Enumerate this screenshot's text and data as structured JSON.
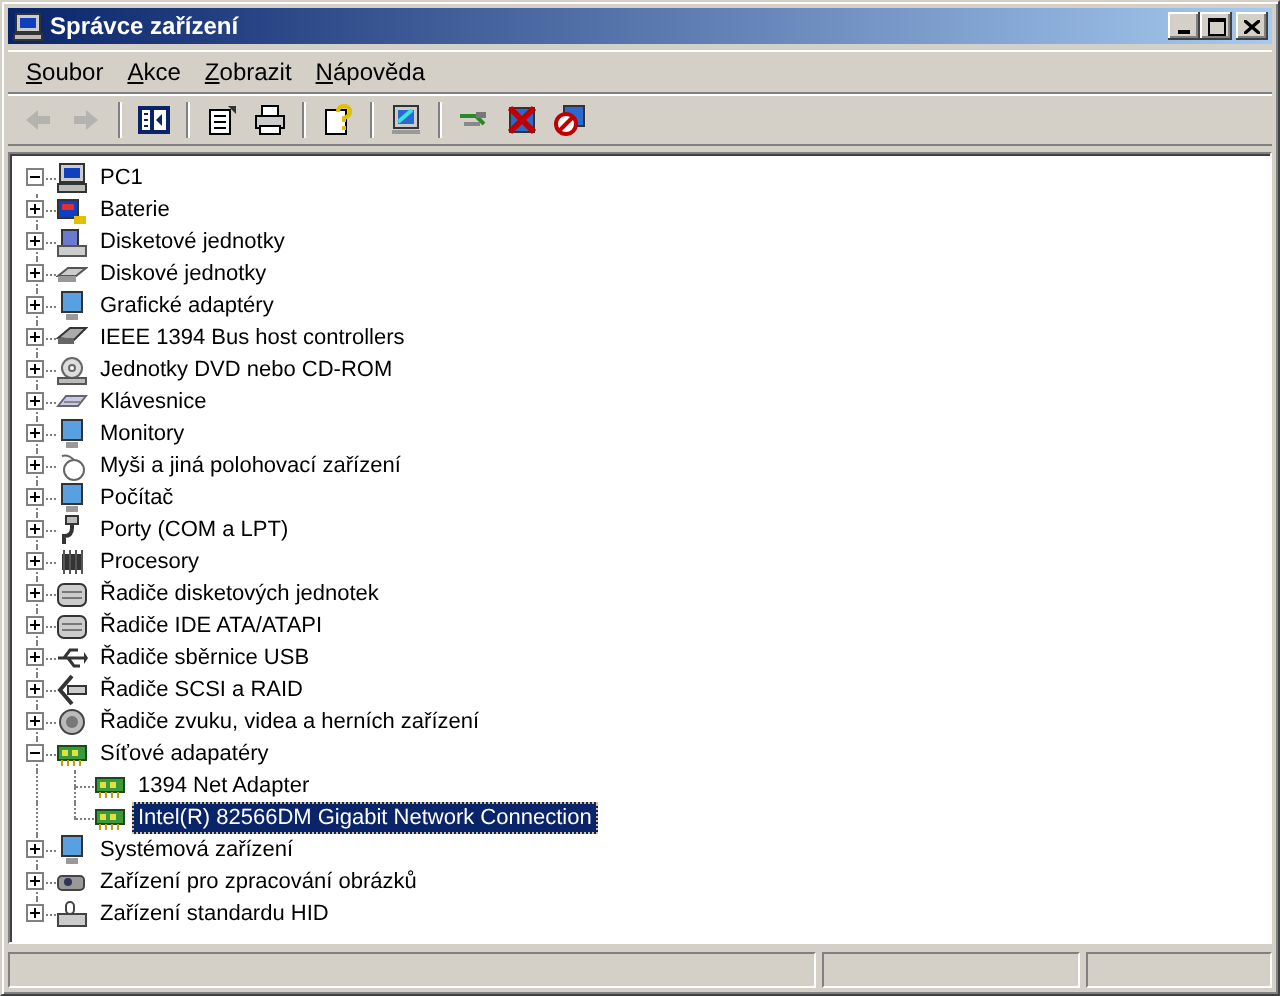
{
  "window": {
    "title": "Správce zařízení"
  },
  "menu": [
    {
      "label": "Soubor"
    },
    {
      "label": "Akce"
    },
    {
      "label": "Zobrazit"
    },
    {
      "label": "Nápověda"
    }
  ],
  "toolbar": [
    {
      "disabled": true
    },
    {
      "disabled": true
    },
    {
      "disabled": false
    },
    {
      "disabled": false
    },
    {
      "disabled": false
    },
    {
      "disabled": false
    },
    {
      "disabled": false
    },
    {
      "disabled": false
    },
    {
      "disabled": false
    },
    {
      "disabled": false
    }
  ],
  "tree": {
    "label": "PC1",
    "expanded": true,
    "selected": false,
    "children": [
      {
        "label": "Baterie",
        "expanded": false,
        "selected": false
      },
      {
        "label": "Disketové jednotky",
        "expanded": false,
        "selected": false
      },
      {
        "label": "Diskové jednotky",
        "expanded": false,
        "selected": false
      },
      {
        "label": "Grafické adaptéry",
        "expanded": false,
        "selected": false
      },
      {
        "label": "IEEE 1394 Bus host controllers",
        "expanded": false,
        "selected": false
      },
      {
        "label": "Jednotky DVD nebo CD-ROM",
        "expanded": false,
        "selected": false
      },
      {
        "label": "Klávesnice",
        "expanded": false,
        "selected": false
      },
      {
        "label": "Monitory",
        "expanded": false,
        "selected": false
      },
      {
        "label": "Myši a jiná polohovací zařízení",
        "expanded": false,
        "selected": false
      },
      {
        "label": "Počítač",
        "expanded": false,
        "selected": false
      },
      {
        "label": "Porty (COM a LPT)",
        "expanded": false,
        "selected": false
      },
      {
        "label": "Procesory",
        "expanded": false,
        "selected": false
      },
      {
        "label": "Řadiče disketových jednotek",
        "expanded": false,
        "selected": false
      },
      {
        "label": "Řadiče IDE ATA/ATAPI",
        "expanded": false,
        "selected": false
      },
      {
        "label": "Řadiče sběrnice USB",
        "expanded": false,
        "selected": false
      },
      {
        "label": "Řadiče SCSI a RAID",
        "expanded": false,
        "selected": false
      },
      {
        "label": "Řadiče zvuku, videa a herních zařízení",
        "expanded": false,
        "selected": false
      },
      {
        "label": "Síťové adapatéry",
        "expanded": true,
        "selected": false,
        "children": [
          {
            "label": "1394 Net Adapter",
            "selected": false
          },
          {
            "label": "Intel(R) 82566DM Gigabit Network Connection",
            "selected": true
          }
        ]
      },
      {
        "label": "Systémová zařízení",
        "expanded": false,
        "selected": false
      },
      {
        "label": "Zařízení pro zpracování obrázků",
        "expanded": false,
        "selected": false
      },
      {
        "label": "Zařízení standardu HID",
        "expanded": false,
        "selected": false
      }
    ]
  }
}
